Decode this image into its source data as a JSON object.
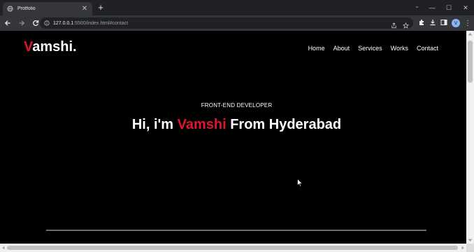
{
  "browser": {
    "tab": {
      "title": "Protfolio",
      "close_glyph": "✕",
      "favicon": "globe-icon"
    },
    "newtab_glyph": "+",
    "window_controls": {
      "tabsearch": "⌄",
      "minimize": "—",
      "maximize": "☐",
      "close": "✕"
    },
    "url": {
      "host": "127.0.0.1",
      "rest": ":5500/index.html#contact"
    },
    "profile_initial": "V",
    "menu_glyph": "⋮"
  },
  "site": {
    "logo": {
      "accent": "V",
      "rest": "amshi."
    },
    "nav": [
      "Home",
      "About",
      "Services",
      "Works",
      "Contact"
    ],
    "subtitle": "FRONT-END DEVELOPER",
    "headline": {
      "pre": "Hi, i'm ",
      "name": "Vamshi",
      "post": " From Hyderabad"
    }
  },
  "colors": {
    "accent": "#e0142c",
    "background": "#000000",
    "chrome_dark": "#202124",
    "chrome_toolbar": "#35363a"
  }
}
